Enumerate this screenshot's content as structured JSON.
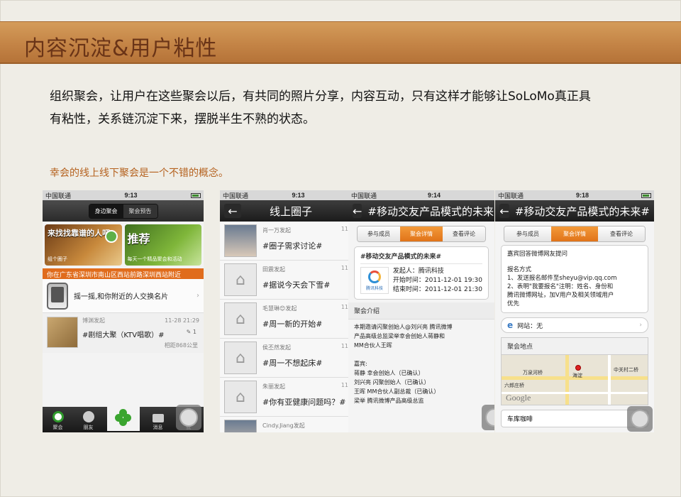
{
  "slide": {
    "title": "内容沉淀&用户粘性",
    "body_line1": "组织聚会，让用户在这些聚会以后，有共同的照片分享，内容互动，只有这样才能够让SoLoMo真正具",
    "body_line2": "有粘性，关系链沉淀下来，摆脱半生不熟的状态。",
    "subtitle": "幸会的线上线下聚会是一个不错的概念。"
  },
  "screen1": {
    "carrier": "中国联通",
    "time": "9:13",
    "seg_nearby": "身边聚会",
    "seg_preview": "聚会预告",
    "banner1_title": "来找找靠谱的人吧",
    "banner1_sub": "组个圈子",
    "banner2_title": "推荐",
    "banner2_sub": "每天一个精品聚会和活动",
    "location": "你在广东省深圳市南山区西站前路深圳西站附近",
    "shake": "摇一摇,和你附近的人交换名片",
    "event": {
      "by": "博渊发起",
      "title": "#剧组大聚（KTV唱歌）#",
      "time": "11-28 21:29",
      "count": "1",
      "distance": "相距868公里"
    },
    "tabs": [
      "聚会",
      "朋友",
      "",
      "消息",
      "我"
    ]
  },
  "screen2": {
    "carrier": "中国联通",
    "time": "9:13",
    "title": "线上圈子",
    "rows": [
      {
        "by": "肖一万发起",
        "title": "#圈子需求讨论#",
        "num": "11"
      },
      {
        "by": "田震发起",
        "title": "#据说今天会下雪#",
        "num": "11"
      },
      {
        "by": "毛慧琳😊发起",
        "title": "#周一新的开始#",
        "num": "11"
      },
      {
        "by": "侯丕然发起",
        "title": "#周一不想起床#",
        "num": "11"
      },
      {
        "by": "朱丽发起",
        "title": "#你有亚健康问题吗？#",
        "num": "11"
      },
      {
        "by": "Cindy.Jiang发起",
        "title": "",
        "num": ""
      }
    ]
  },
  "screen3": {
    "carrier": "中国联通",
    "time": "9:14",
    "title": "#移动交友产品模式的未来#",
    "tabs": [
      "参与成员",
      "聚会详情",
      "查看评论"
    ],
    "event_title": "#移动交友产品模式的未来#",
    "org_name": "腾讯科技",
    "initiator": "发起人：腾讯科技",
    "start": "开始时间：2011-12-01 19:30",
    "end": "结束时间：2011-12-01 21:30",
    "intro_head": "聚会介绍",
    "intro_lines": [
      "本期邀请闪聚创始人@刘兴亮 腾讯微博",
      "产品高级总监梁举幸会创始人蒋静和",
      "MM合伙人王晖",
      "",
      "嘉宾:",
      "蒋静    幸会创始人（已确认）",
      "刘兴亮  闪聚创始人（已确认）",
      "王晖    MM合伙人副总裁（已确认）",
      "梁举    腾讯微博产品高级总监"
    ]
  },
  "screen4": {
    "carrier": "中国联通",
    "time": "9:18",
    "title": "#移动交友产品模式的未来#",
    "tabs": [
      "参与成员",
      "聚会详情",
      "查看评论"
    ],
    "card_lines": [
      "嘉宾回答微博网友提问",
      "",
      "报名方式",
      "1、发送报名邮件至sheyu@vip.qq.com",
      "2、表明\"我要报名\"注明：姓名、身份和",
      "腾讯微博网址，加V用户及相关领域用户",
      "优先"
    ],
    "website": "网站：无",
    "location_head": "聚会地点",
    "map_labels": [
      "万泉河桥",
      "六郎庄桥",
      "中关村二桥",
      "海淀"
    ],
    "venue": "车库咖啡"
  }
}
